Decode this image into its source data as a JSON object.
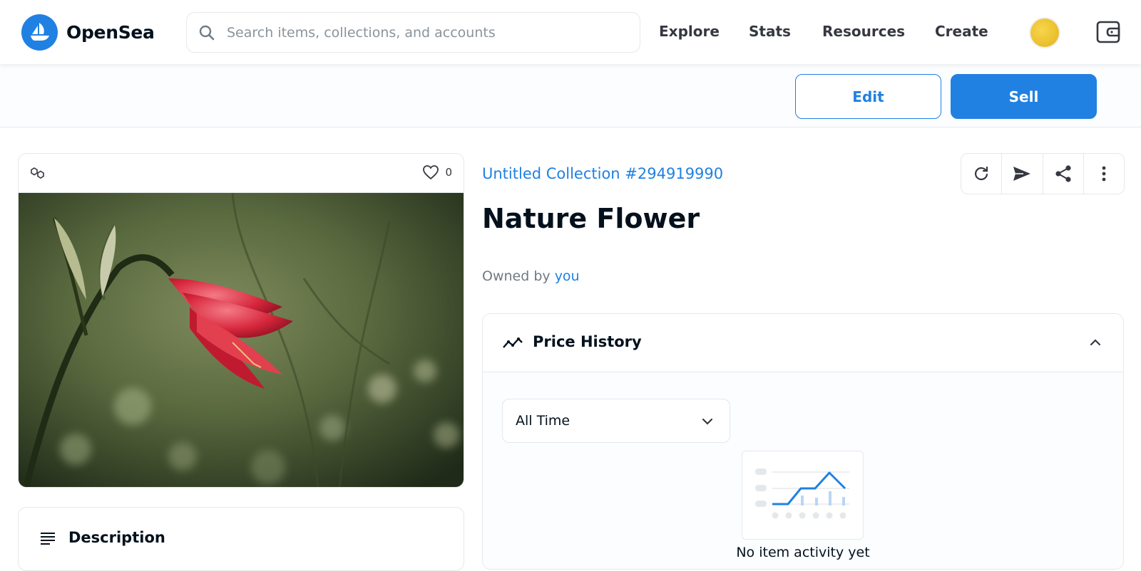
{
  "brand": {
    "name": "OpenSea",
    "logo_icon": "opensea-logo-icon"
  },
  "search": {
    "placeholder": "Search items, collections, and accounts",
    "value": ""
  },
  "nav": {
    "explore": "Explore",
    "stats": "Stats",
    "resources": "Resources",
    "create": "Create"
  },
  "actions": {
    "edit": "Edit",
    "sell": "Sell"
  },
  "item": {
    "favorites_count": "0",
    "collection_name": "Untitled Collection #294919990",
    "name": "Nature Flower",
    "owned_by_label": "Owned by",
    "owner": "you"
  },
  "description": {
    "title": "Description"
  },
  "price_history": {
    "title": "Price History",
    "range_selected": "All Time",
    "empty_text": "No item activity yet"
  },
  "colors": {
    "accent": "#2081e2",
    "text": "#04111d",
    "muted": "#707a83",
    "border": "#e5e8eb"
  }
}
